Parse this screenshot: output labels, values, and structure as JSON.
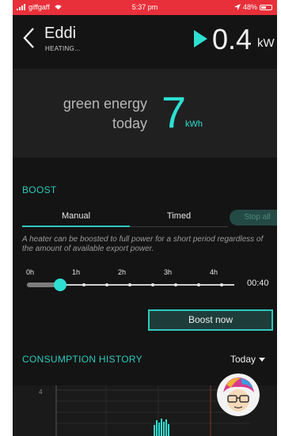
{
  "status_bar": {
    "carrier": "giffgaff",
    "time": "5:37 pm",
    "battery": "48%"
  },
  "header": {
    "device_name": "Eddi",
    "device_status": "HEATING...",
    "power_value": "0.4",
    "power_unit": "kW"
  },
  "green_energy": {
    "label_line1": "green energy",
    "label_line2": "today",
    "value": "7",
    "unit": "kWh"
  },
  "boost": {
    "title": "BOOST",
    "tabs": [
      {
        "label": "Manual",
        "selected": true
      },
      {
        "label": "Timed",
        "selected": false
      }
    ],
    "stop_all_label": "Stop all",
    "description": "A heater can be boosted to full power for a short period regardless of the amount of available export power.",
    "slider": {
      "labels": [
        "0h",
        "1h",
        "2h",
        "3h",
        "4h"
      ],
      "value_fraction": 0.167,
      "time_value": "00:40"
    },
    "boost_now_label": "Boost now"
  },
  "consumption_history": {
    "title": "CONSUMPTION HISTORY",
    "period": "Today",
    "chart_data": {
      "type": "bar",
      "y_tick_labels": [
        "4"
      ]
    }
  },
  "colors": {
    "accent": "#2de0d2",
    "status_bar": "#e8303a",
    "background": "#141414"
  }
}
